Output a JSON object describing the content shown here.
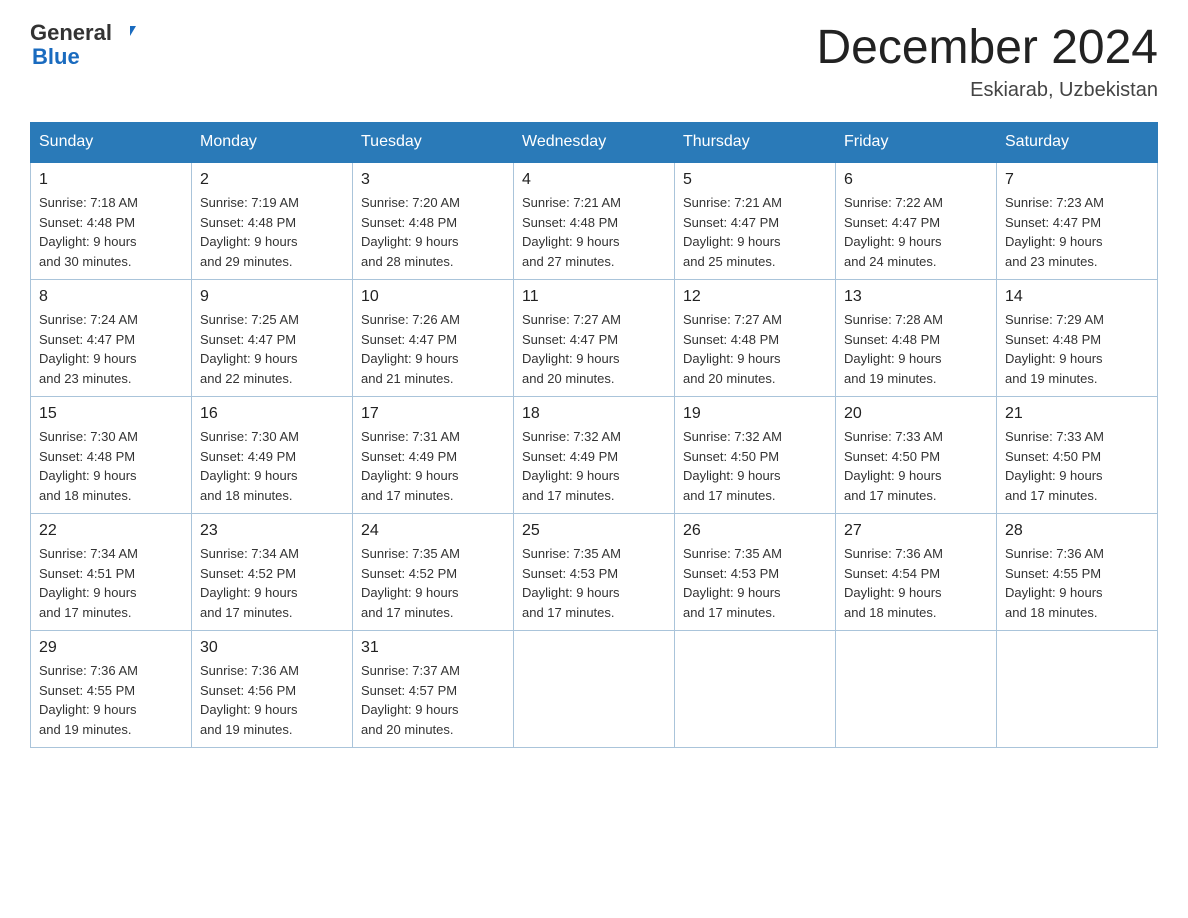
{
  "header": {
    "logo_general": "General",
    "logo_blue": "Blue",
    "title": "December 2024",
    "subtitle": "Eskiarab, Uzbekistan"
  },
  "days_of_week": [
    "Sunday",
    "Monday",
    "Tuesday",
    "Wednesday",
    "Thursday",
    "Friday",
    "Saturday"
  ],
  "weeks": [
    [
      {
        "day": "1",
        "sunrise": "7:18 AM",
        "sunset": "4:48 PM",
        "daylight": "9 hours and 30 minutes."
      },
      {
        "day": "2",
        "sunrise": "7:19 AM",
        "sunset": "4:48 PM",
        "daylight": "9 hours and 29 minutes."
      },
      {
        "day": "3",
        "sunrise": "7:20 AM",
        "sunset": "4:48 PM",
        "daylight": "9 hours and 28 minutes."
      },
      {
        "day": "4",
        "sunrise": "7:21 AM",
        "sunset": "4:48 PM",
        "daylight": "9 hours and 27 minutes."
      },
      {
        "day": "5",
        "sunrise": "7:21 AM",
        "sunset": "4:47 PM",
        "daylight": "9 hours and 25 minutes."
      },
      {
        "day": "6",
        "sunrise": "7:22 AM",
        "sunset": "4:47 PM",
        "daylight": "9 hours and 24 minutes."
      },
      {
        "day": "7",
        "sunrise": "7:23 AM",
        "sunset": "4:47 PM",
        "daylight": "9 hours and 23 minutes."
      }
    ],
    [
      {
        "day": "8",
        "sunrise": "7:24 AM",
        "sunset": "4:47 PM",
        "daylight": "9 hours and 23 minutes."
      },
      {
        "day": "9",
        "sunrise": "7:25 AM",
        "sunset": "4:47 PM",
        "daylight": "9 hours and 22 minutes."
      },
      {
        "day": "10",
        "sunrise": "7:26 AM",
        "sunset": "4:47 PM",
        "daylight": "9 hours and 21 minutes."
      },
      {
        "day": "11",
        "sunrise": "7:27 AM",
        "sunset": "4:47 PM",
        "daylight": "9 hours and 20 minutes."
      },
      {
        "day": "12",
        "sunrise": "7:27 AM",
        "sunset": "4:48 PM",
        "daylight": "9 hours and 20 minutes."
      },
      {
        "day": "13",
        "sunrise": "7:28 AM",
        "sunset": "4:48 PM",
        "daylight": "9 hours and 19 minutes."
      },
      {
        "day": "14",
        "sunrise": "7:29 AM",
        "sunset": "4:48 PM",
        "daylight": "9 hours and 19 minutes."
      }
    ],
    [
      {
        "day": "15",
        "sunrise": "7:30 AM",
        "sunset": "4:48 PM",
        "daylight": "9 hours and 18 minutes."
      },
      {
        "day": "16",
        "sunrise": "7:30 AM",
        "sunset": "4:49 PM",
        "daylight": "9 hours and 18 minutes."
      },
      {
        "day": "17",
        "sunrise": "7:31 AM",
        "sunset": "4:49 PM",
        "daylight": "9 hours and 17 minutes."
      },
      {
        "day": "18",
        "sunrise": "7:32 AM",
        "sunset": "4:49 PM",
        "daylight": "9 hours and 17 minutes."
      },
      {
        "day": "19",
        "sunrise": "7:32 AM",
        "sunset": "4:50 PM",
        "daylight": "9 hours and 17 minutes."
      },
      {
        "day": "20",
        "sunrise": "7:33 AM",
        "sunset": "4:50 PM",
        "daylight": "9 hours and 17 minutes."
      },
      {
        "day": "21",
        "sunrise": "7:33 AM",
        "sunset": "4:50 PM",
        "daylight": "9 hours and 17 minutes."
      }
    ],
    [
      {
        "day": "22",
        "sunrise": "7:34 AM",
        "sunset": "4:51 PM",
        "daylight": "9 hours and 17 minutes."
      },
      {
        "day": "23",
        "sunrise": "7:34 AM",
        "sunset": "4:52 PM",
        "daylight": "9 hours and 17 minutes."
      },
      {
        "day": "24",
        "sunrise": "7:35 AM",
        "sunset": "4:52 PM",
        "daylight": "9 hours and 17 minutes."
      },
      {
        "day": "25",
        "sunrise": "7:35 AM",
        "sunset": "4:53 PM",
        "daylight": "9 hours and 17 minutes."
      },
      {
        "day": "26",
        "sunrise": "7:35 AM",
        "sunset": "4:53 PM",
        "daylight": "9 hours and 17 minutes."
      },
      {
        "day": "27",
        "sunrise": "7:36 AM",
        "sunset": "4:54 PM",
        "daylight": "9 hours and 18 minutes."
      },
      {
        "day": "28",
        "sunrise": "7:36 AM",
        "sunset": "4:55 PM",
        "daylight": "9 hours and 18 minutes."
      }
    ],
    [
      {
        "day": "29",
        "sunrise": "7:36 AM",
        "sunset": "4:55 PM",
        "daylight": "9 hours and 19 minutes."
      },
      {
        "day": "30",
        "sunrise": "7:36 AM",
        "sunset": "4:56 PM",
        "daylight": "9 hours and 19 minutes."
      },
      {
        "day": "31",
        "sunrise": "7:37 AM",
        "sunset": "4:57 PM",
        "daylight": "9 hours and 20 minutes."
      },
      null,
      null,
      null,
      null
    ]
  ],
  "labels": {
    "sunrise": "Sunrise:",
    "sunset": "Sunset:",
    "daylight": "Daylight:"
  }
}
